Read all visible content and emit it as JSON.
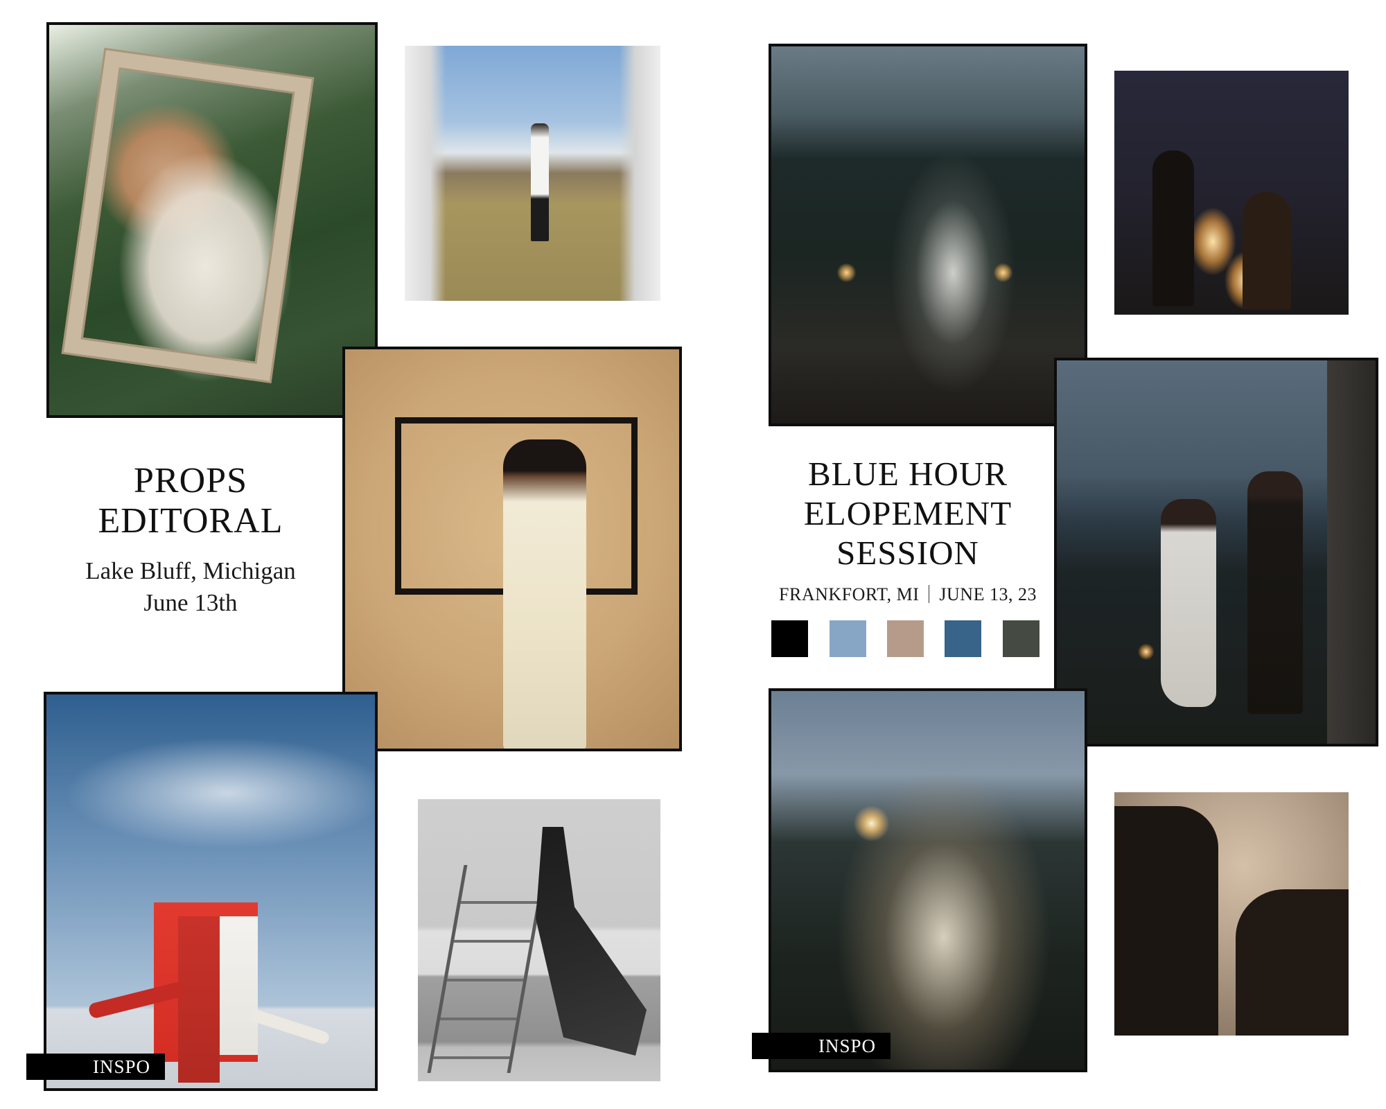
{
  "left_board": {
    "title_line1": "PROPS",
    "title_line2": "EDITORAL",
    "location": "Lake Bluff, Michigan",
    "date": "June 13th",
    "tag_label": "INSPO"
  },
  "right_board": {
    "title_line1": "BLUE HOUR",
    "title_line2": "ELOPEMENT",
    "title_line3": "SESSION",
    "location": "FRANKFORT, MI",
    "date": "JUNE 13, 23",
    "tag_label": "INSPO",
    "palette": [
      "#000000",
      "#87a6c5",
      "#b69b8b",
      "#376488",
      "#454b43"
    ]
  }
}
